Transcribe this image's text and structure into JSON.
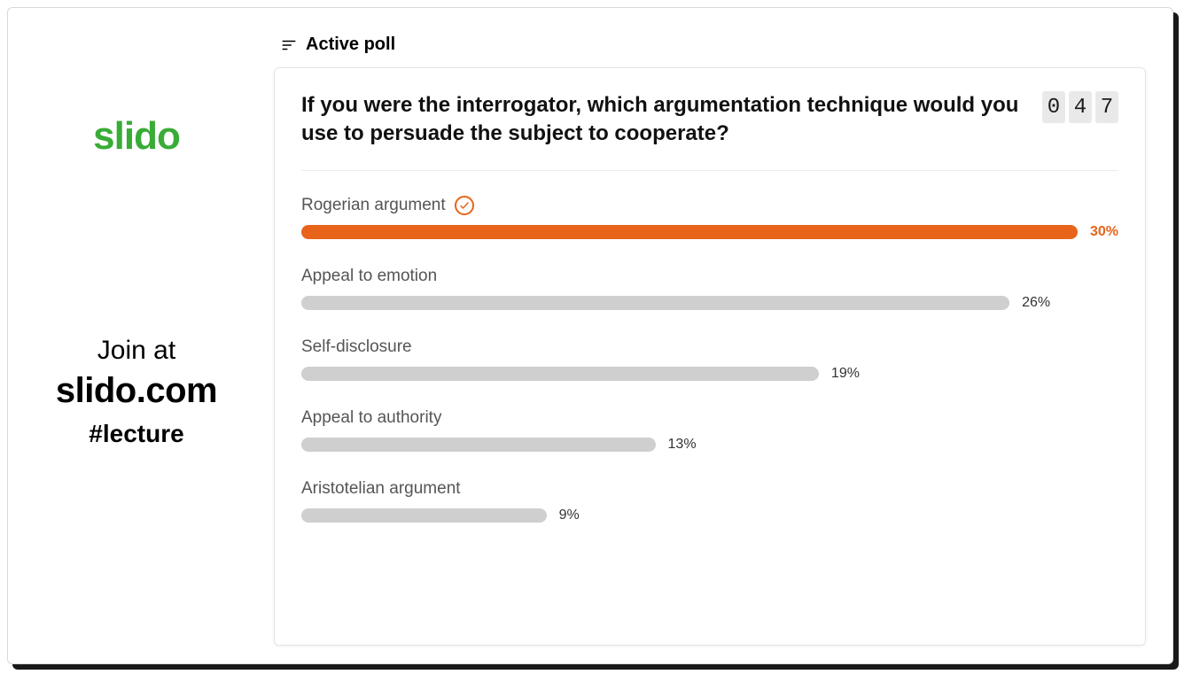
{
  "brand": {
    "logo_text": "slido"
  },
  "join": {
    "prefix": "Join at",
    "url": "slido.com",
    "code": "#lecture"
  },
  "header": {
    "label": "Active poll"
  },
  "poll": {
    "question": "If you were the interrogator, which argumentation technique would you use to persuade the subject to cooperate?",
    "counter_digits": [
      "0",
      "4",
      "7"
    ]
  },
  "chart_data": {
    "type": "bar",
    "orientation": "horizontal",
    "title": "If you were the interrogator, which argumentation technique would you use to persuade the subject to cooperate?",
    "xlabel": "",
    "ylabel": "",
    "categories": [
      "Rogerian argument",
      "Appeal to emotion",
      "Self-disclosure",
      "Appeal to authority",
      "Aristotelian argument"
    ],
    "values": [
      30,
      26,
      19,
      13,
      9
    ],
    "value_suffix": "%",
    "highlight_index": 0,
    "max_bar_percent_of_track": 100,
    "colors": {
      "default": "#cfcfcf",
      "highlight": "#e8641b"
    }
  }
}
